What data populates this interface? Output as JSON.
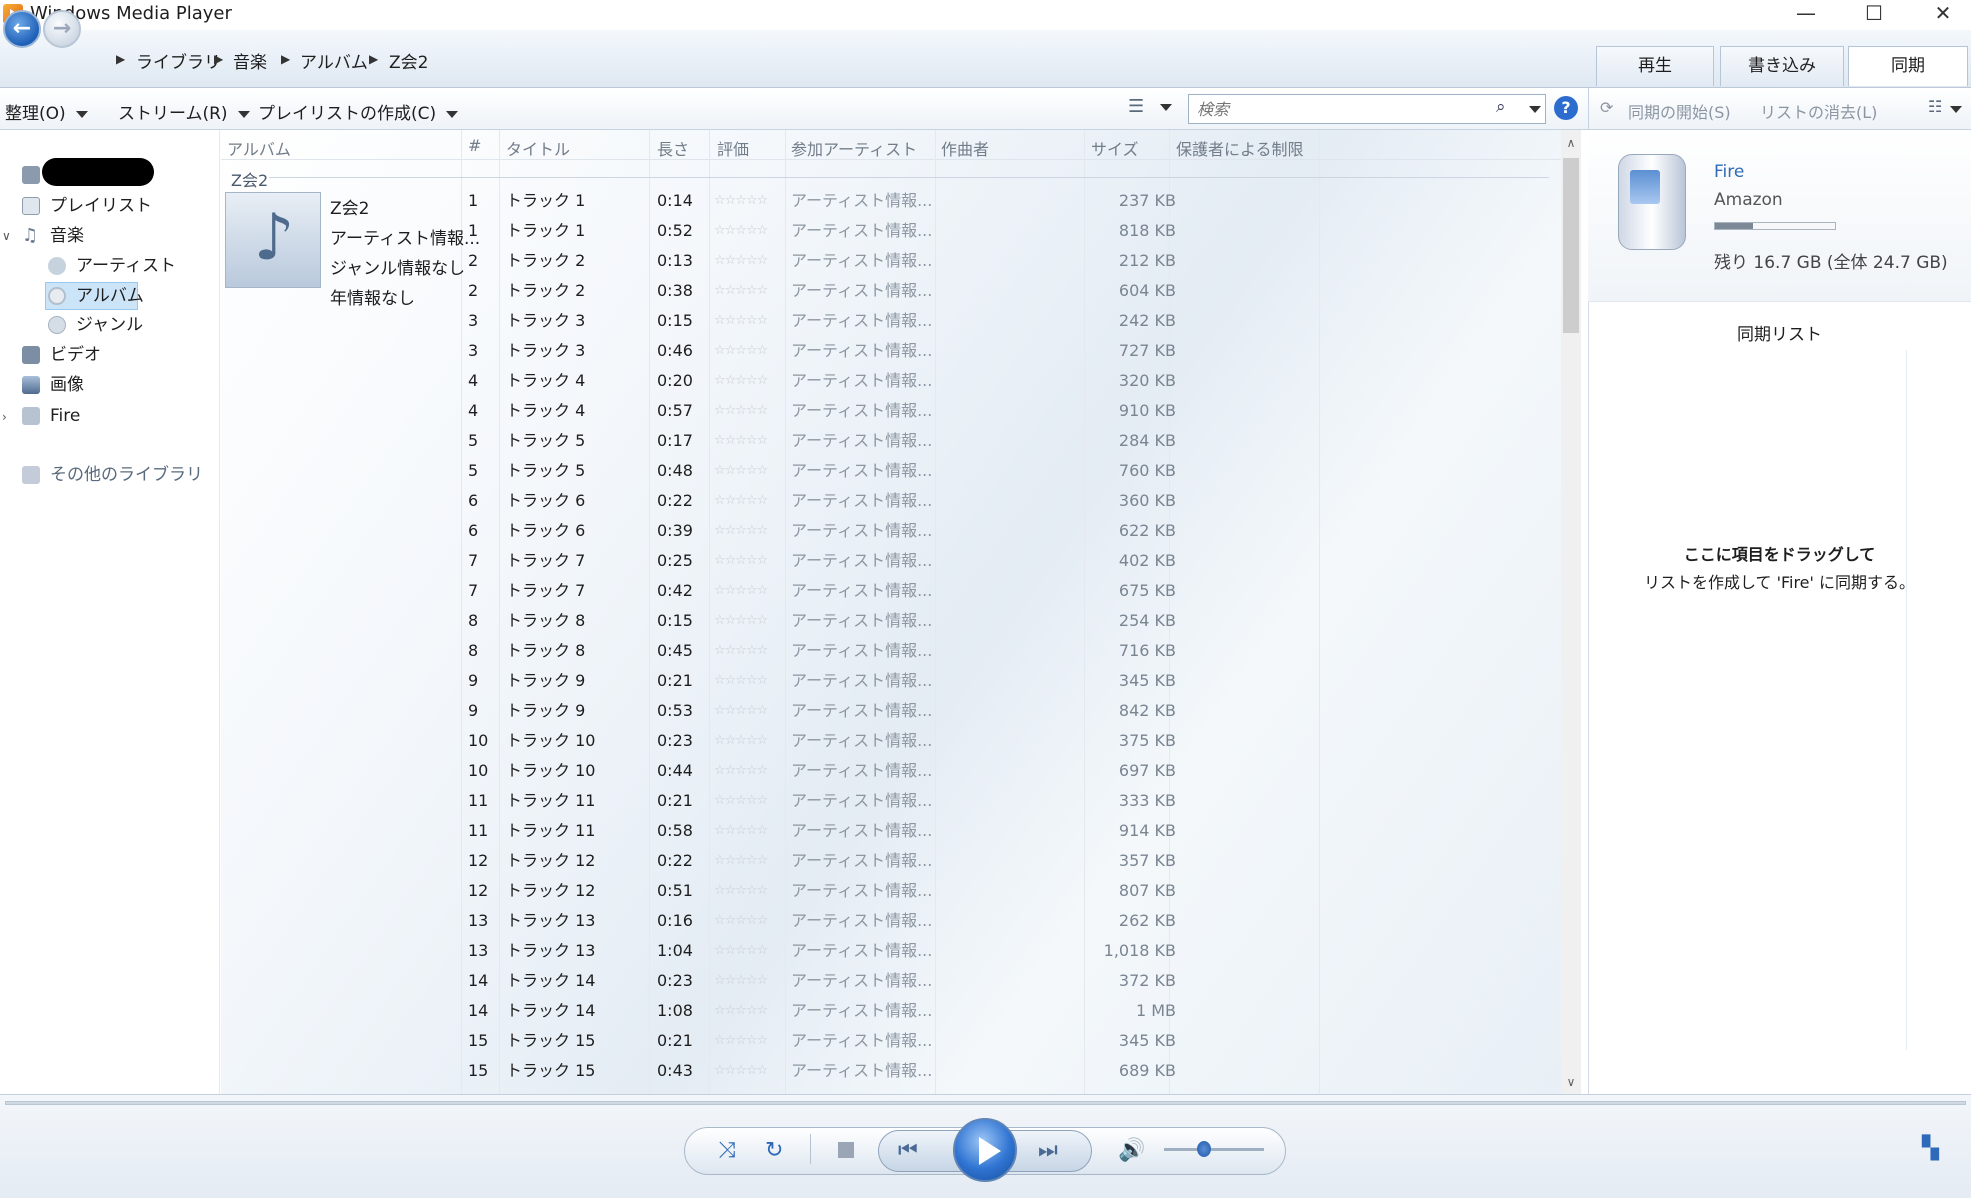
{
  "window": {
    "title": "Windows Media Player",
    "minimize": "—",
    "maximize": "☐",
    "close": "✕"
  },
  "breadcrumb": [
    "ライブラリ",
    "音楽",
    "アルバム",
    "Z会2"
  ],
  "tabs": {
    "play": "再生",
    "burn": "書き込み",
    "sync": "同期"
  },
  "toolbar": {
    "organize": "整理(O)",
    "stream": "ストリーム(R)",
    "create_playlist": "プレイリストの作成(C)"
  },
  "search": {
    "placeholder": "検索"
  },
  "sync_toolbar": {
    "start_sync": "同期の開始(S)",
    "clear_list": "リストの消去(L)"
  },
  "nav": {
    "playlists": "プレイリスト",
    "music": "音楽",
    "artists": "アーティスト",
    "albums": "アルバム",
    "genres": "ジャンル",
    "videos": "ビデオ",
    "pictures": "画像",
    "device": "Fire",
    "other_libraries": "その他のライブラリ"
  },
  "columns": {
    "album": "アルバム",
    "num": "#",
    "title": "タイトル",
    "length": "長さ",
    "rating": "評価",
    "artist": "参加アーティスト",
    "composer": "作曲者",
    "size": "サイズ",
    "parental": "保護者による制限"
  },
  "album_group": {
    "name": "Z会2",
    "info": [
      "Z会2",
      "アーティスト情報...",
      "ジャンル情報なし",
      "年情報なし"
    ]
  },
  "rating_stars": "☆☆☆☆☆",
  "tracks": [
    {
      "num": "1",
      "title": "トラック 1",
      "length": "0:14",
      "artist": "アーティスト情報...",
      "size": "237 KB"
    },
    {
      "num": "1",
      "title": "トラック 1",
      "length": "0:52",
      "artist": "アーティスト情報...",
      "size": "818 KB"
    },
    {
      "num": "2",
      "title": "トラック 2",
      "length": "0:13",
      "artist": "アーティスト情報...",
      "size": "212 KB"
    },
    {
      "num": "2",
      "title": "トラック 2",
      "length": "0:38",
      "artist": "アーティスト情報...",
      "size": "604 KB"
    },
    {
      "num": "3",
      "title": "トラック 3",
      "length": "0:15",
      "artist": "アーティスト情報...",
      "size": "242 KB"
    },
    {
      "num": "3",
      "title": "トラック 3",
      "length": "0:46",
      "artist": "アーティスト情報...",
      "size": "727 KB"
    },
    {
      "num": "4",
      "title": "トラック 4",
      "length": "0:20",
      "artist": "アーティスト情報...",
      "size": "320 KB"
    },
    {
      "num": "4",
      "title": "トラック 4",
      "length": "0:57",
      "artist": "アーティスト情報...",
      "size": "910 KB"
    },
    {
      "num": "5",
      "title": "トラック 5",
      "length": "0:17",
      "artist": "アーティスト情報...",
      "size": "284 KB"
    },
    {
      "num": "5",
      "title": "トラック 5",
      "length": "0:48",
      "artist": "アーティスト情報...",
      "size": "760 KB"
    },
    {
      "num": "6",
      "title": "トラック 6",
      "length": "0:22",
      "artist": "アーティスト情報...",
      "size": "360 KB"
    },
    {
      "num": "6",
      "title": "トラック 6",
      "length": "0:39",
      "artist": "アーティスト情報...",
      "size": "622 KB"
    },
    {
      "num": "7",
      "title": "トラック 7",
      "length": "0:25",
      "artist": "アーティスト情報...",
      "size": "402 KB"
    },
    {
      "num": "7",
      "title": "トラック 7",
      "length": "0:42",
      "artist": "アーティスト情報...",
      "size": "675 KB"
    },
    {
      "num": "8",
      "title": "トラック 8",
      "length": "0:15",
      "artist": "アーティスト情報...",
      "size": "254 KB"
    },
    {
      "num": "8",
      "title": "トラック 8",
      "length": "0:45",
      "artist": "アーティスト情報...",
      "size": "716 KB"
    },
    {
      "num": "9",
      "title": "トラック 9",
      "length": "0:21",
      "artist": "アーティスト情報...",
      "size": "345 KB"
    },
    {
      "num": "9",
      "title": "トラック 9",
      "length": "0:53",
      "artist": "アーティスト情報...",
      "size": "842 KB"
    },
    {
      "num": "10",
      "title": "トラック 10",
      "length": "0:23",
      "artist": "アーティスト情報...",
      "size": "375 KB"
    },
    {
      "num": "10",
      "title": "トラック 10",
      "length": "0:44",
      "artist": "アーティスト情報...",
      "size": "697 KB"
    },
    {
      "num": "11",
      "title": "トラック 11",
      "length": "0:21",
      "artist": "アーティスト情報...",
      "size": "333 KB"
    },
    {
      "num": "11",
      "title": "トラック 11",
      "length": "0:58",
      "artist": "アーティスト情報...",
      "size": "914 KB"
    },
    {
      "num": "12",
      "title": "トラック 12",
      "length": "0:22",
      "artist": "アーティスト情報...",
      "size": "357 KB"
    },
    {
      "num": "12",
      "title": "トラック 12",
      "length": "0:51",
      "artist": "アーティスト情報...",
      "size": "807 KB"
    },
    {
      "num": "13",
      "title": "トラック 13",
      "length": "0:16",
      "artist": "アーティスト情報...",
      "size": "262 KB"
    },
    {
      "num": "13",
      "title": "トラック 13",
      "length": "1:04",
      "artist": "アーティスト情報...",
      "size": "1,018 KB"
    },
    {
      "num": "14",
      "title": "トラック 14",
      "length": "0:23",
      "artist": "アーティスト情報...",
      "size": "372 KB"
    },
    {
      "num": "14",
      "title": "トラック 14",
      "length": "1:08",
      "artist": "アーティスト情報...",
      "size": "1 MB"
    },
    {
      "num": "15",
      "title": "トラック 15",
      "length": "0:21",
      "artist": "アーティスト情報...",
      "size": "345 KB"
    },
    {
      "num": "15",
      "title": "トラック 15",
      "length": "0:43",
      "artist": "アーティスト情報...",
      "size": "689 KB"
    }
  ],
  "device": {
    "name": "Fire",
    "maker": "Amazon",
    "used_fraction": 0.32,
    "space": "残り 16.7 GB (全体 24.7 GB)"
  },
  "sync_list": {
    "title": "同期リスト",
    "hint_line1": "ここに項目をドラッグして",
    "hint_line2": "リストを作成して 'Fire' に同期する。"
  },
  "player": {
    "volume_fraction": 0.35
  },
  "colors": {
    "accent": "#2e6ab9",
    "link": "#2f6bb5",
    "selected": "#cce4f7"
  }
}
